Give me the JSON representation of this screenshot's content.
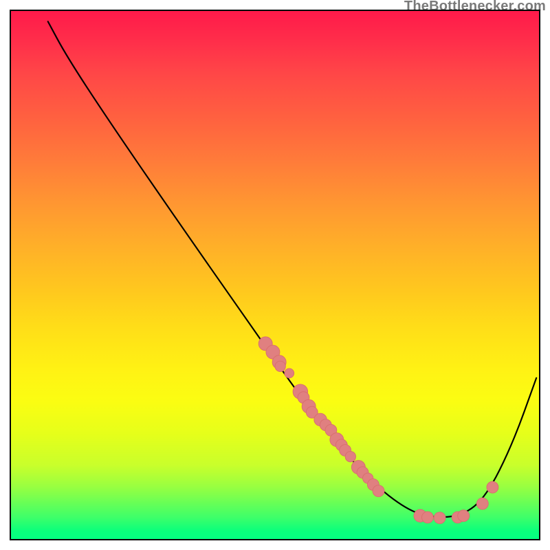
{
  "watermark": {
    "text": "TheBottlenecker.com"
  },
  "colors": {
    "curve_stroke": "#000000",
    "point_fill": "#e08080",
    "point_stroke": "#d86e6e",
    "gradient_top": "#ff1a4a",
    "gradient_bottom": "#04ff82"
  },
  "chart_data": {
    "type": "line",
    "title": "",
    "xlabel": "",
    "ylabel": "",
    "xlim": [
      0,
      100
    ],
    "ylim": [
      0,
      100
    ],
    "grid": false,
    "notes": "U-shaped bottleneck curve over a red-to-green vertical gradient. Minimum (best) region is between roughly x=77 and x=86. Scatter points are clustered along the descending slope ~x=48-70 and along the bottom ~x=77-90. No axis ticks or numeric labels are shown in the image; x/y values are read off as percentages of the plot area with y=0 at the top.",
    "curve_path": [
      {
        "x": 7.0,
        "y": 2.0
      },
      {
        "x": 10.5,
        "y": 8.5
      },
      {
        "x": 18.0,
        "y": 20.0
      },
      {
        "x": 30.0,
        "y": 37.5
      },
      {
        "x": 45.0,
        "y": 59.0
      },
      {
        "x": 58.0,
        "y": 77.5
      },
      {
        "x": 68.0,
        "y": 89.0
      },
      {
        "x": 75.0,
        "y": 94.5
      },
      {
        "x": 80.0,
        "y": 96.0
      },
      {
        "x": 85.5,
        "y": 95.6
      },
      {
        "x": 90.0,
        "y": 92.0
      },
      {
        "x": 95.0,
        "y": 82.0
      },
      {
        "x": 99.5,
        "y": 69.5
      }
    ],
    "scatter_points": [
      {
        "x": 48.2,
        "y": 63.0,
        "r": 1.3
      },
      {
        "x": 49.6,
        "y": 64.6,
        "r": 1.3
      },
      {
        "x": 50.8,
        "y": 66.5,
        "r": 1.3
      },
      {
        "x": 51.0,
        "y": 67.3,
        "r": 1.0
      },
      {
        "x": 52.7,
        "y": 68.6,
        "r": 0.9
      },
      {
        "x": 54.8,
        "y": 72.1,
        "r": 1.4
      },
      {
        "x": 55.4,
        "y": 73.2,
        "r": 1.1
      },
      {
        "x": 56.4,
        "y": 74.9,
        "r": 1.3
      },
      {
        "x": 57.0,
        "y": 76.0,
        "r": 1.1
      },
      {
        "x": 58.6,
        "y": 77.4,
        "r": 1.2
      },
      {
        "x": 59.6,
        "y": 78.4,
        "r": 1.1
      },
      {
        "x": 60.6,
        "y": 79.4,
        "r": 1.1
      },
      {
        "x": 61.7,
        "y": 81.2,
        "r": 1.3
      },
      {
        "x": 62.6,
        "y": 82.2,
        "r": 1.1
      },
      {
        "x": 63.3,
        "y": 83.2,
        "r": 1.1
      },
      {
        "x": 64.3,
        "y": 84.4,
        "r": 1.0
      },
      {
        "x": 65.8,
        "y": 86.4,
        "r": 1.3
      },
      {
        "x": 66.6,
        "y": 87.4,
        "r": 1.1
      },
      {
        "x": 67.6,
        "y": 88.5,
        "r": 1.0
      },
      {
        "x": 68.6,
        "y": 89.7,
        "r": 1.1
      },
      {
        "x": 69.6,
        "y": 90.9,
        "r": 1.1
      },
      {
        "x": 77.5,
        "y": 95.6,
        "r": 1.2
      },
      {
        "x": 78.9,
        "y": 95.9,
        "r": 1.1
      },
      {
        "x": 81.2,
        "y": 96.0,
        "r": 1.1
      },
      {
        "x": 84.6,
        "y": 95.9,
        "r": 1.1
      },
      {
        "x": 85.7,
        "y": 95.6,
        "r": 1.1
      },
      {
        "x": 89.3,
        "y": 93.3,
        "r": 1.1
      },
      {
        "x": 91.2,
        "y": 90.2,
        "r": 1.1
      }
    ]
  }
}
